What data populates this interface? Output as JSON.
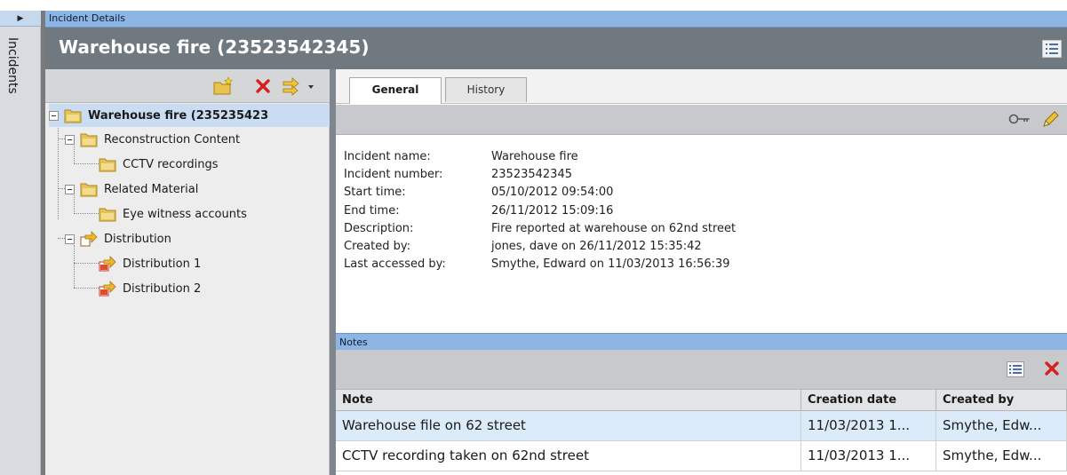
{
  "rail": {
    "toggle_icon": "triangle-right-icon",
    "label": "Incidents"
  },
  "details_bar": {
    "label": "Incident Details"
  },
  "title": {
    "text": "Warehouse fire (23523542345)"
  },
  "tree": {
    "items": [
      {
        "label": "Warehouse fire (235235423",
        "icon": "folder-icon",
        "bold": true
      },
      {
        "label": "Reconstruction Content",
        "icon": "folder-icon"
      },
      {
        "label": "CCTV recordings",
        "icon": "folder-icon"
      },
      {
        "label": "Related Material",
        "icon": "folder-icon"
      },
      {
        "label": "Eye witness accounts",
        "icon": "folder-icon"
      },
      {
        "label": "Distribution",
        "icon": "distribution-icon"
      },
      {
        "label": "Distribution 1",
        "icon": "distribution-icon"
      },
      {
        "label": "Distribution 2",
        "icon": "distribution-icon"
      }
    ]
  },
  "tabs": [
    {
      "label": "General",
      "active": true
    },
    {
      "label": "History",
      "active": false
    }
  ],
  "general": {
    "fields": [
      {
        "label": "Incident name:",
        "value": "Warehouse fire"
      },
      {
        "label": "Incident number:",
        "value": "23523542345"
      },
      {
        "label": "Start time:",
        "value": "05/10/2012 09:54:00"
      },
      {
        "label": "End time:",
        "value": "26/11/2012 15:09:16"
      },
      {
        "label": "Description:",
        "value": "Fire reported at warehouse on 62nd street"
      },
      {
        "label": "Created by:",
        "value": "jones, dave on 26/11/2012 15:35:42"
      },
      {
        "label": "Last accessed by:",
        "value": "Smythe, Edward on 11/03/2013 16:56:39"
      }
    ]
  },
  "notes": {
    "bar_label": "Notes",
    "columns": [
      "Note",
      "Creation date",
      "Created by"
    ],
    "rows": [
      [
        "Warehouse file on 62 street",
        "11/03/2013 1...",
        "Smythe, Edw..."
      ],
      [
        "CCTV recording taken on 62nd street",
        "11/03/2013 1...",
        "Smythe, Edw..."
      ]
    ]
  },
  "colors": {
    "accent_bar": "#8cb5e3",
    "title_bg": "#707880",
    "selection": "#c9dcf2",
    "delete_red": "#d62020"
  }
}
